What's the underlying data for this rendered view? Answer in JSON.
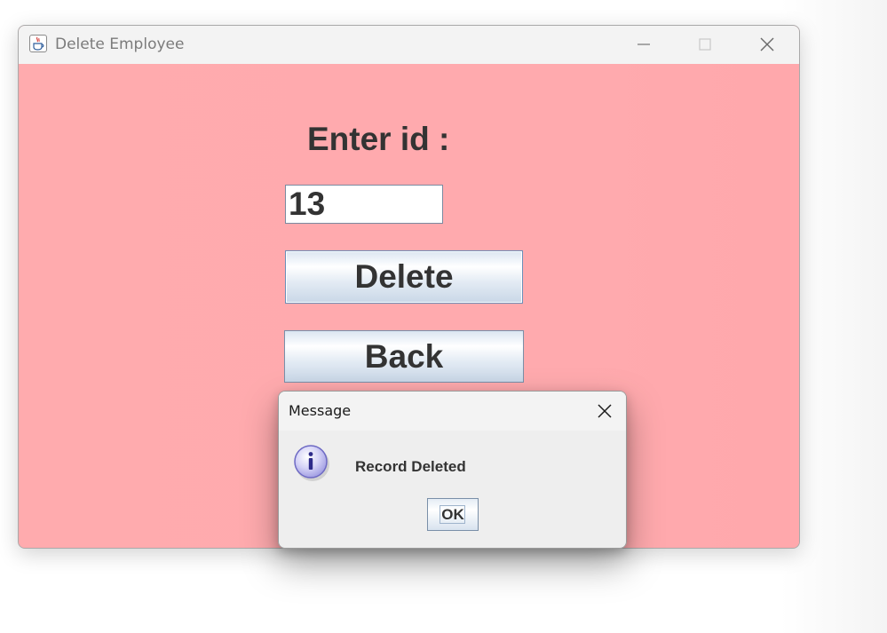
{
  "window": {
    "title": "Delete Employee",
    "background_color": "#ffaaae",
    "controls": {
      "minimize_icon": "minimize-icon",
      "maximize_icon": "maximize-icon",
      "close_icon": "close-icon"
    }
  },
  "form": {
    "id_label": "Enter id :",
    "id_value": "13",
    "delete_label": "Delete",
    "back_label": "Back"
  },
  "dialog": {
    "title": "Message",
    "message": "Record Deleted",
    "icon": "info-icon",
    "ok_label": "OK"
  }
}
